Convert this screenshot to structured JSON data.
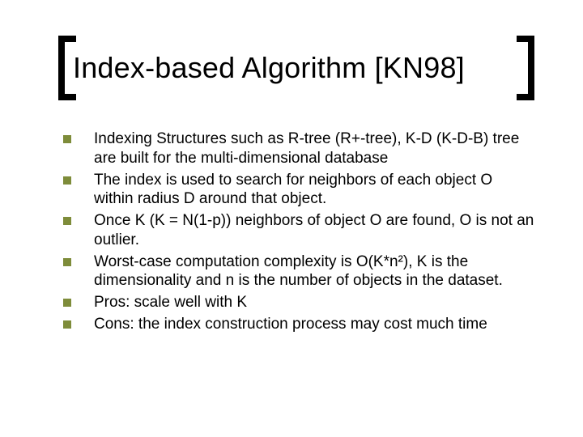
{
  "title": "Index-based Algorithm [KN98]",
  "bullets": [
    "Indexing Structures such as R-tree (R+-tree), K-D (K-D-B) tree are built for the multi-dimensional database",
    "The index is used to search for neighbors of each object O within radius D around that object.",
    "Once K (K = N(1-p)) neighbors of object O are found, O is not an outlier.",
    "Worst-case computation complexity is O(K*n²), K is the dimensionality and n is the number of objects in the dataset.",
    "Pros: scale well with K",
    "Cons: the index construction process may cost much time"
  ]
}
